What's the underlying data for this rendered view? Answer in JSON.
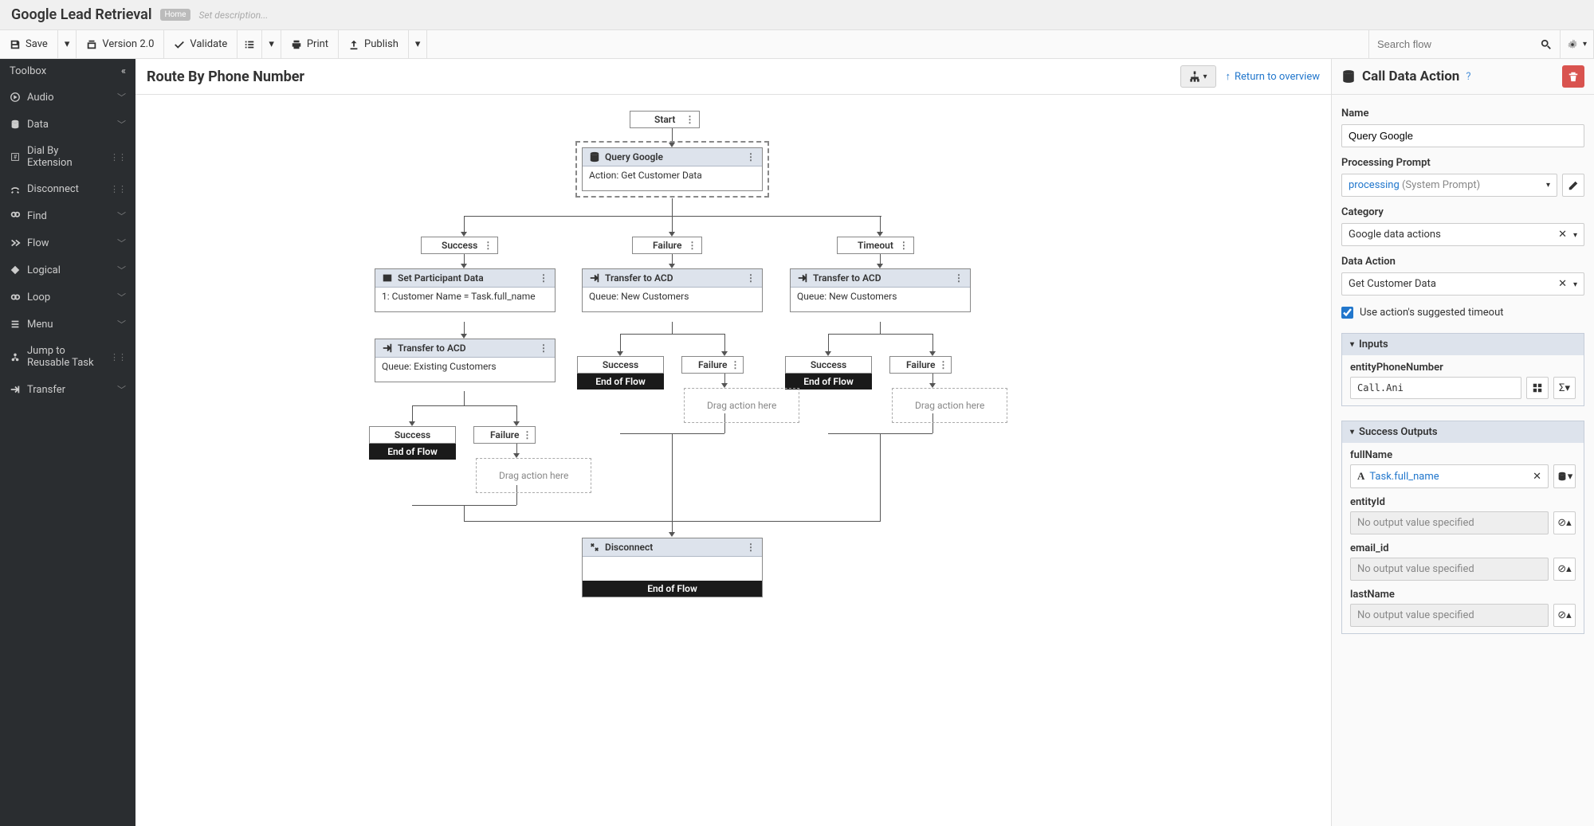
{
  "header": {
    "title": "Google Lead Retrieval",
    "home": "Home",
    "desc": "Set description..."
  },
  "toolbar": {
    "save": "Save",
    "version": "Version 2.0",
    "validate": "Validate",
    "print": "Print",
    "publish": "Publish",
    "search_ph": "Search flow"
  },
  "sidebar": {
    "title": "Toolbox",
    "items": [
      {
        "icon": "play",
        "label": "Audio",
        "exp": true
      },
      {
        "icon": "db",
        "label": "Data",
        "exp": true
      },
      {
        "icon": "dial",
        "label": "Dial By Extension",
        "grip": true
      },
      {
        "icon": "disc",
        "label": "Disconnect",
        "grip": true
      },
      {
        "icon": "find",
        "label": "Find",
        "exp": true
      },
      {
        "icon": "flow",
        "label": "Flow",
        "exp": true
      },
      {
        "icon": "logic",
        "label": "Logical",
        "exp": true
      },
      {
        "icon": "loop",
        "label": "Loop",
        "exp": true
      },
      {
        "icon": "menu",
        "label": "Menu",
        "exp": true
      },
      {
        "icon": "jump",
        "label": "Jump to Reusable Task",
        "grip": true
      },
      {
        "icon": "xfer",
        "label": "Transfer",
        "exp": true
      }
    ]
  },
  "canvas": {
    "title": "Route By Phone Number",
    "return": "Return to overview",
    "start": "Start",
    "query": {
      "title": "Query Google",
      "body": "Action: Get Customer Data"
    },
    "b_success": "Success",
    "b_failure": "Failure",
    "b_timeout": "Timeout",
    "spd": {
      "title": "Set Participant Data",
      "body": "1: Customer Name = Task.full_name"
    },
    "tacd1": {
      "title": "Transfer to ACD",
      "body": "Queue: New Customers"
    },
    "tacd2": {
      "title": "Transfer to ACD",
      "body": "Queue: New Customers"
    },
    "tacd3": {
      "title": "Transfer to ACD",
      "body": "Queue: Existing Customers"
    },
    "eof": "End of Flow",
    "drop": "Drag action here",
    "disc": {
      "title": "Disconnect"
    }
  },
  "rpanel": {
    "title": "Call Data Action",
    "name_lbl": "Name",
    "name_val": "Query Google",
    "proc_lbl": "Processing Prompt",
    "proc_link": "processing",
    "proc_suffix": " (System Prompt)",
    "cat_lbl": "Category",
    "cat_val": "Google data actions",
    "da_lbl": "Data Action",
    "da_val": "Get Customer Data",
    "chk": "Use action's suggested timeout",
    "inputs": "Inputs",
    "in1_lbl": "entityPhoneNumber",
    "in1_val": "Call.Ani",
    "outputs": "Success Outputs",
    "o1_lbl": "fullName",
    "o1_val": "Task.full_name",
    "o2_lbl": "entityId",
    "o_empty": "No output value specified",
    "o3_lbl": "email_id",
    "o4_lbl": "lastName"
  }
}
